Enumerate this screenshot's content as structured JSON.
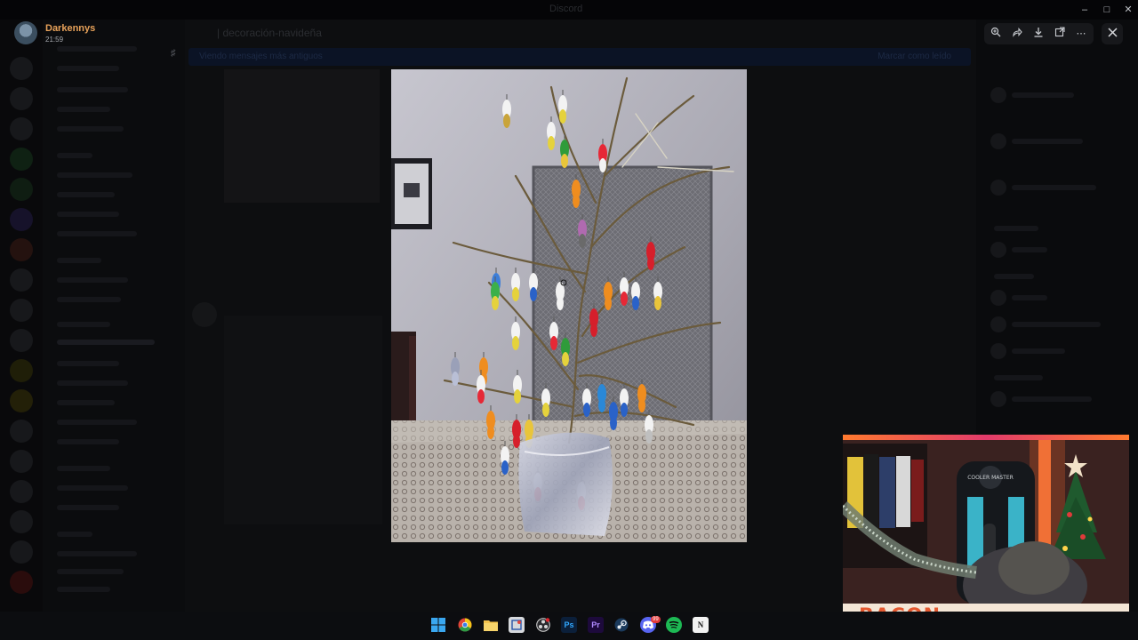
{
  "window": {
    "title": "Discord"
  },
  "user": {
    "name": "Darkennys",
    "time": "21:59"
  },
  "chat": {
    "channel": "| decoración-navideña",
    "notice_left": "Viendo mensajes más antiguos",
    "notice_right": "Marcar como leído"
  },
  "viewer": {
    "toolbar": [
      "zoom-in-icon",
      "forward-icon",
      "download-icon",
      "open-external-icon",
      "more-icon"
    ]
  },
  "webcam": {
    "banner": "BACON",
    "chair_brand": "COOLER MASTER"
  },
  "taskbar": {
    "apps": [
      "windows-start-icon",
      "chrome-icon",
      "file-explorer-icon",
      "snipping-tool-icon",
      "obs-icon",
      "photoshop-icon",
      "premiere-icon",
      "steam-icon",
      "discord-icon",
      "spotify-icon",
      "notion-icon"
    ],
    "photoshop_label": "Ps",
    "premiere_label": "Pr",
    "notion_label": "N",
    "discord_badge": "99"
  },
  "colors": {
    "username": "#e8a25a",
    "banner_text": "#e4582f",
    "banner_bg": "#f4e6d6"
  }
}
